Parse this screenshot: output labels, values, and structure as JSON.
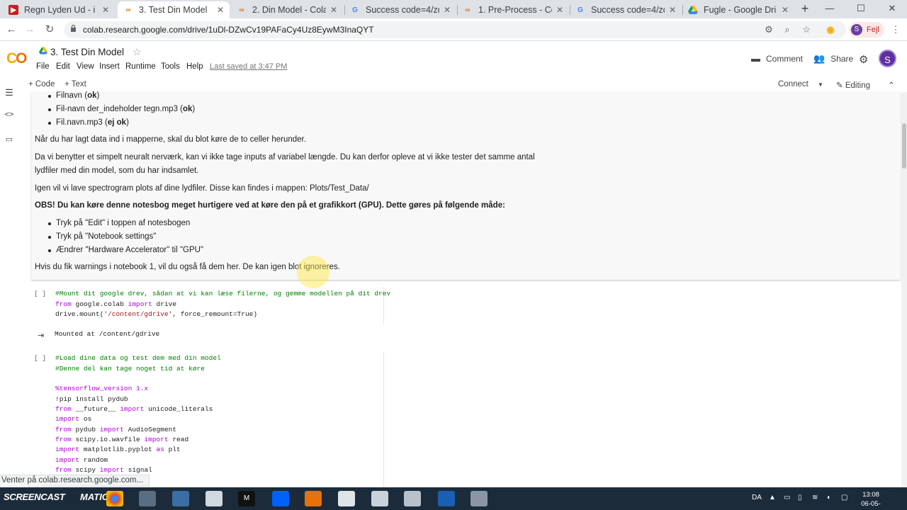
{
  "browser": {
    "tabs": [
      {
        "title": "Regn Lyden Ud - i",
        "fav": "youtube-like-icon"
      },
      {
        "title": "3. Test Din Model",
        "fav": "colab-icon",
        "active": true
      },
      {
        "title": "2. Din Model - Cola",
        "fav": "colab-icon"
      },
      {
        "title": "Success code=4/zq",
        "fav": "google-icon"
      },
      {
        "title": "1. Pre-Process - Co",
        "fav": "colab-icon"
      },
      {
        "title": "Success code=4/zq",
        "fav": "google-icon"
      },
      {
        "title": "Fugle - Google Dri",
        "fav": "drive-icon"
      }
    ],
    "new_tab": "+",
    "tab_close": "✕",
    "window_controls": {
      "minimize": "—",
      "maximize": "☐",
      "close": "✕"
    },
    "url": "colab.research.google.com/drive/1uDl-DZwCv19PAFaCy4Uz8EywM3InaQYT",
    "profile_initial": "S",
    "profile_label": "Fejl"
  },
  "colab": {
    "notebook_title": "3. Test Din Model",
    "menu": [
      "File",
      "Edit",
      "View",
      "Insert",
      "Runtime",
      "Tools",
      "Help"
    ],
    "last_saved": "Last saved at 3:47 PM",
    "comment_label": "Comment",
    "share_label": "Share",
    "user_initial": "S",
    "toolbar": {
      "code_label": "+ Code",
      "text_label": "+ Text",
      "connect_label": "Connect",
      "editing_label": "Editing"
    },
    "text_cell": {
      "bullets_top": [
        {
          "prefix": "Filnavn (",
          "bold": "ok",
          "suffix": ")"
        },
        {
          "prefix": "Fil-navn der_indeholder tegn.mp3 (",
          "bold": "ok",
          "suffix": ")"
        },
        {
          "prefix": "Fil.navn.mp3 (",
          "bold": "ej ok",
          "suffix": ")"
        }
      ],
      "p1": "Når du har lagt data ind i mapperne, skal du blot køre de to celler herunder.",
      "p2_line1": "Da vi benytter et simpelt neuralt nerværk, kan vi ikke tage inputs af variabel længde. Du kan derfor opleve at vi ikke tester det samme antal",
      "p2_line2": "lydfiler med din model, som du har indsamlet.",
      "p3": "Igen vil vi lave spectrogram plots af dine lydfiler. Disse kan findes i mappen: Plots/Test_Data/",
      "p4": "OBS! Du kan køre denne notesbog meget hurtigere ved at køre den på et grafikkort (GPU). Dette gøres på følgende måde:",
      "bullets_bottom": [
        "Tryk på \"Edit\" i toppen af notesbogen",
        "Tryk på \"Notebook settings\"",
        "Ændrer \"Hardware Accelerator\" til \"GPU\""
      ],
      "p5": "Hvis du fik warnings i notebook 1, vil du også få dem her. De kan igen blot ignoreres."
    },
    "code_cell_1": {
      "run": "[ ]",
      "line1": "#Mount dit google drev, sådan at vi kan læse filerne, og gemme modellen på dit drev",
      "line2": {
        "kw1": "from",
        "mod": " google.colab ",
        "kw2": "import",
        "rest": " drive"
      },
      "line3": {
        "a": "drive.mount(",
        "s": "'/content/gdrive'",
        "b": ", force_remount=True)"
      },
      "output": "Mounted at /content/gdrive"
    },
    "code_cell_2": {
      "run": "[ ]",
      "comment1": "#Load dine data og test dem med din model",
      "comment2": "#Denne del kan tage noget tid at køre",
      "magic": "%tensorflow_version 1.x",
      "pip": "!pip install pydub",
      "l_future": {
        "kw1": "from",
        "mod": " __future__ ",
        "kw2": "import",
        "rest": " unicode_literals"
      },
      "l_os": {
        "kw": "import",
        "rest": " os"
      },
      "l_pydub": {
        "kw1": "from",
        "mod": " pydub ",
        "kw2": "import",
        "rest": " AudioSegment"
      },
      "l_wav": {
        "kw1": "from",
        "mod": " scipy.io.wavfile ",
        "kw2": "import",
        "rest": " read"
      },
      "l_plt": {
        "kw1": "import",
        "mod": " matplotlib.pyplot ",
        "kw2": "as",
        "rest": " plt"
      },
      "l_random": {
        "kw": "import",
        "rest": " random"
      },
      "l_signal": {
        "kw1": "from",
        "mod": " scipy ",
        "kw2": "import",
        "rest": " signal"
      }
    },
    "status_text": "Venter på colab.research.google.com..."
  },
  "taskbar": {
    "watermark_top": "RECORDED WITH",
    "watermark_brand": "SCREENCAST",
    "watermark_brand2": "MATIC",
    "lang": "DA",
    "time": "13:08",
    "date": "06-05-2020"
  },
  "colors": {
    "colab_orange": "#f9ab00",
    "code_green": "#008000",
    "keyword_purple": "#af00db",
    "string_red": "#a31515"
  }
}
